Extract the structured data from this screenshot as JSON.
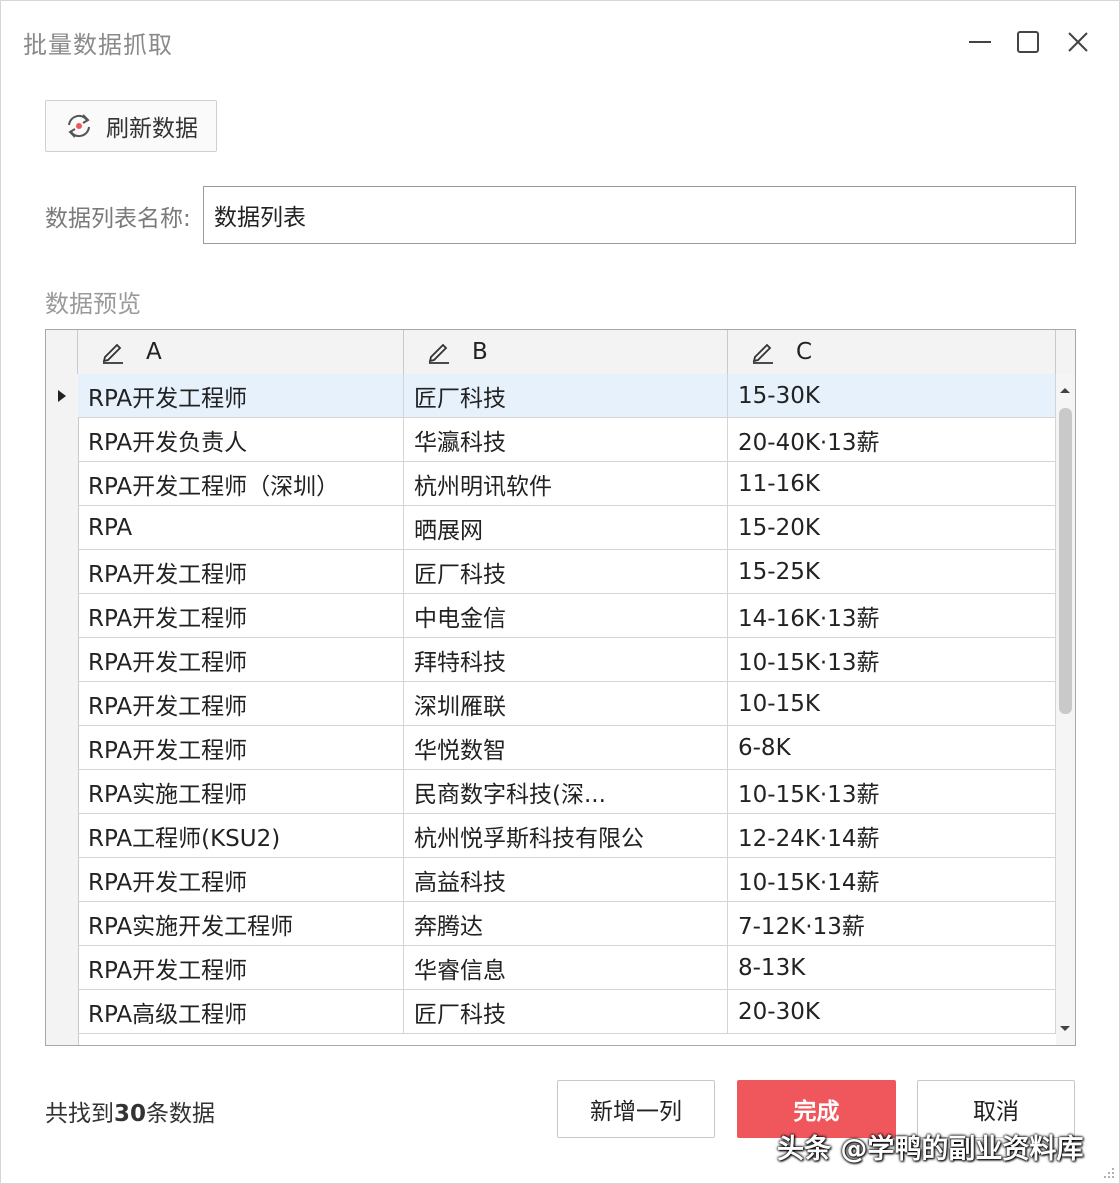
{
  "window": {
    "title": "批量数据抓取"
  },
  "toolbar": {
    "refresh_label": "刷新数据"
  },
  "list_name": {
    "label": "数据列表名称:",
    "value": "数据列表"
  },
  "preview": {
    "label": "数据预览",
    "columns": [
      "A",
      "B",
      "C"
    ],
    "rows": [
      [
        "RPA开发工程师",
        "匠厂科技",
        "15-30K"
      ],
      [
        "RPA开发负责人",
        "华瀛科技",
        "20-40K·13薪"
      ],
      [
        "RPA开发工程师（深圳）",
        "杭州明讯软件",
        "11-16K"
      ],
      [
        "RPA",
        "晒展网",
        "15-20K"
      ],
      [
        "RPA开发工程师",
        "匠厂科技",
        "15-25K"
      ],
      [
        "RPA开发工程师",
        "中电金信",
        "14-16K·13薪"
      ],
      [
        "RPA开发工程师",
        "拜特科技",
        "10-15K·13薪"
      ],
      [
        "RPA开发工程师",
        "深圳雁联",
        "10-15K"
      ],
      [
        "RPA开发工程师",
        "华悦数智",
        "6-8K"
      ],
      [
        "RPA实施工程师",
        "民商数字科技(深...",
        "10-15K·13薪"
      ],
      [
        "RPA工程师(KSU2)",
        "杭州悦孚斯科技有限公",
        "12-24K·14薪"
      ],
      [
        "RPA开发工程师",
        "高益科技",
        "10-15K·14薪"
      ],
      [
        "RPA实施开发工程师",
        "奔腾达",
        "7-12K·13薪"
      ],
      [
        "RPA开发工程师",
        "华睿信息",
        "8-13K"
      ],
      [
        "RPA高级工程师",
        "匠厂科技",
        "20-30K"
      ]
    ]
  },
  "status": {
    "prefix": "共找到",
    "count": "30",
    "suffix": "条数据"
  },
  "buttons": {
    "add_column": "新增一列",
    "done": "完成",
    "cancel": "取消"
  },
  "watermark": "头条 @学鸭的副业资料库",
  "icons": {
    "refresh": "refresh-icon",
    "edit": "pencil-icon",
    "minimize": "minimize-icon",
    "maximize": "maximize-icon",
    "close": "close-icon",
    "row_pointer": "triangle-right-icon"
  },
  "colors": {
    "accent": "#f0575c",
    "selected_row": "#e6f1fb"
  }
}
